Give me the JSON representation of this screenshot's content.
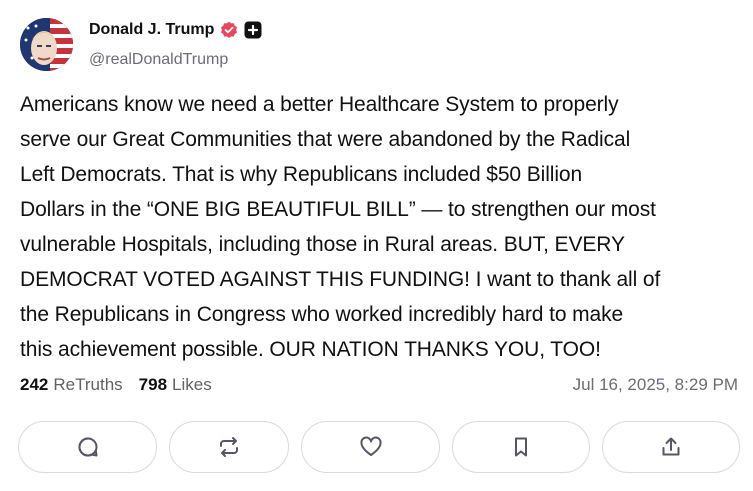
{
  "author": {
    "name": "Donald J. Trump",
    "handle": "@realDonaldTrump",
    "verified_icon": "verified-badge-icon",
    "plus_icon": "plus-badge-icon",
    "verified_color": "#e8465f"
  },
  "post": {
    "text": "Americans know we need a better Healthcare System to properly\nserve our Great Communities that were abandoned by the Radical\nLeft Democrats. That is why Republicans included $50 Billion\nDollars in the “ONE BIG BEAUTIFUL BILL” — to strengthen our most\nvulnerable Hospitals, including those in Rural areas. BUT, EVERY\nDEMOCRAT VOTED AGAINST THIS FUNDING! I want to thank all of\nthe Republicans in Congress who worked incredibly hard to make\nthis achievement possible. OUR NATION THANKS YOU, TOO!",
    "retruths_count": "242",
    "retruths_label": "ReTruths",
    "likes_count": "798",
    "likes_label": "Likes",
    "timestamp": "Jul 16, 2025, 8:29 PM"
  },
  "actions": [
    {
      "name": "reply",
      "icon": "comment-icon"
    },
    {
      "name": "retruth",
      "icon": "repost-icon"
    },
    {
      "name": "like",
      "icon": "heart-icon"
    },
    {
      "name": "bookmark",
      "icon": "bookmark-icon"
    },
    {
      "name": "share",
      "icon": "share-icon"
    }
  ]
}
